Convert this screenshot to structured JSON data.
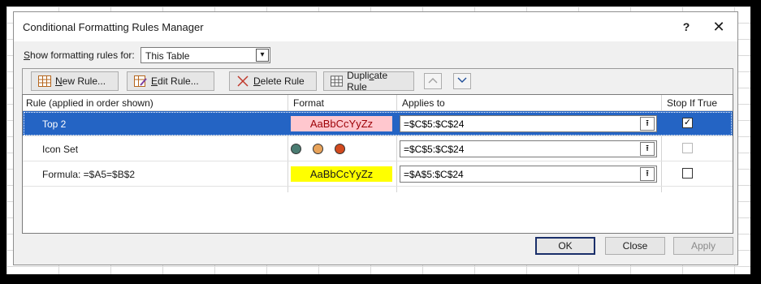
{
  "dialog": {
    "title": "Conditional Formatting Rules Manager",
    "help_glyph": "?",
    "close_glyph": "✕"
  },
  "filter": {
    "label_prefix": "S",
    "label_rest": "how formatting rules for:",
    "selected": "This Table"
  },
  "toolbar": {
    "new_rule_u": "N",
    "new_rule_rest": "ew Rule...",
    "edit_rule_u": "E",
    "edit_rule_rest": "dit Rule...",
    "delete_rule_u": "D",
    "delete_rule_rest": "elete Rule",
    "duplicate_rule_a": "Dupli",
    "duplicate_rule_u": "c",
    "duplicate_rule_b": "ate Rule",
    "move_up_glyph": "⌃",
    "move_down_glyph": "⌄"
  },
  "table": {
    "headers": {
      "rule": "Rule (applied in order shown)",
      "format": "Format",
      "applies_to": "Applies to",
      "stop_if_true": "Stop If True"
    },
    "rows": [
      {
        "rule": "Top 2",
        "format_preview": "AaBbCcYyZz",
        "format_bg": "#ffc7ce",
        "format_color": "#9c0006",
        "applies_to": "=$C$5:$C$24",
        "stop_if_true": true,
        "selected": true
      },
      {
        "rule": "Icon Set",
        "icon_colors": [
          "#4a7c72",
          "#e8a35a",
          "#d24a1e"
        ],
        "applies_to": "=$C$5:$C$24",
        "stop_if_true": false,
        "selected": false
      },
      {
        "rule": "Formula: =$A5=$B$2",
        "format_preview": "AaBbCcYyZz",
        "format_bg": "#ffff00",
        "format_color": "#1a1a1a",
        "applies_to": "=$A$5:$C$24",
        "stop_if_true": false,
        "selected": false
      }
    ]
  },
  "footer": {
    "ok": "OK",
    "close": "Close",
    "apply": "Apply"
  },
  "colors": {
    "selection": "#2464c4",
    "dialog_bg": "#f0f0f0"
  }
}
